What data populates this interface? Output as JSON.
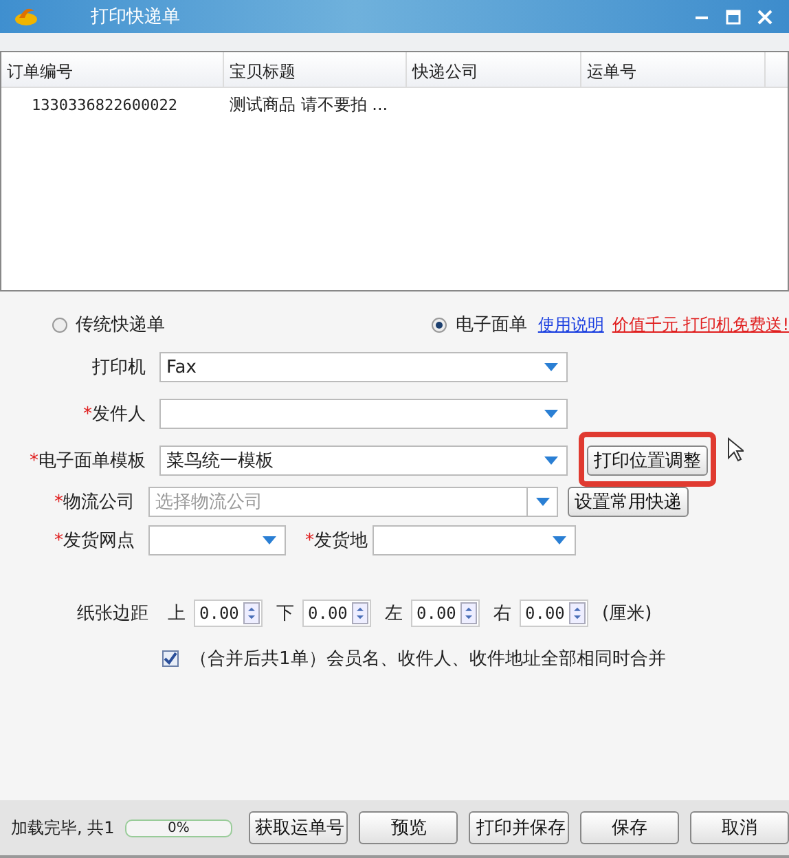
{
  "window": {
    "title": "打印快递单"
  },
  "table": {
    "columns": [
      "订单编号",
      "宝贝标题",
      "快递公司",
      "运单号"
    ],
    "rows": [
      {
        "order_no": "1330336822600022",
        "item_title": "测试商品 请不要拍 ..."
      }
    ]
  },
  "mode": [
    {
      "label": "传统快递单",
      "selected": false
    },
    {
      "label": "电子面单",
      "selected": true
    }
  ],
  "links": [
    {
      "label": "使用说明",
      "kind": "help"
    },
    {
      "label": "价值千元 打印机免费送!",
      "kind": "promo"
    }
  ],
  "printer": {
    "label": "打印机",
    "value": "Fax"
  },
  "sender": {
    "mark": "*",
    "label": "发件人"
  },
  "template": {
    "mark": "*",
    "label": "电子面单模板",
    "value": "菜鸟统一模板",
    "button": "打印位置调整",
    "highlighted": true
  },
  "logistics": {
    "mark": "*",
    "label": "物流公司",
    "placeholder": "选择物流公司",
    "button": "设置常用快递"
  },
  "branch": {
    "mark": "*",
    "label": "发货网点"
  },
  "origin": {
    "mark": "*",
    "label": "发货地"
  },
  "margins": {
    "label": "纸张边距",
    "items": [
      {
        "label": "上",
        "value": "0.00"
      },
      {
        "label": "下",
        "value": "0.00"
      },
      {
        "label": "左",
        "value": "0.00"
      },
      {
        "label": "右",
        "value": "0.00"
      }
    ],
    "unit": "(厘米)"
  },
  "merge": {
    "checked": true,
    "label": "（合并后共1单）会员名、收件人、收件地址全部相同时合并"
  },
  "status": {
    "text": "加载完毕, 共1",
    "level": 0,
    "reading": "0%"
  },
  "buttons": [
    "获取运单号",
    "预览",
    "打印并保存",
    "保存",
    "取消"
  ]
}
